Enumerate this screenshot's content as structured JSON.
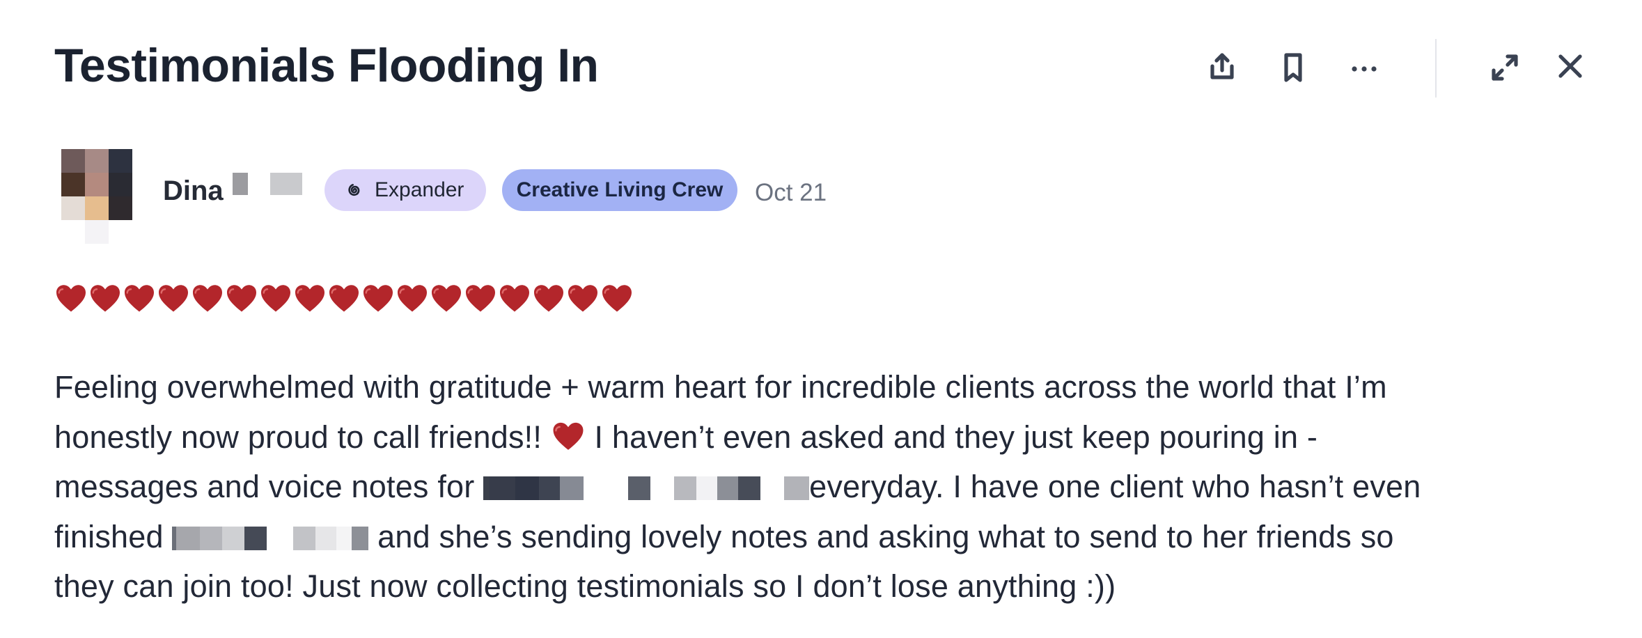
{
  "post": {
    "title": "Testimonials Flooding In",
    "author_name": "Dina",
    "badges": {
      "expander_label": "Expander",
      "group_label": "Creative Living Crew"
    },
    "date": "Oct 21",
    "hearts_count": 17,
    "body": {
      "line1": "Feeling overwhelmed with gratitude + warm heart for incredible clients across the world that I’m",
      "line2a": "honestly now proud to call friends!!",
      "line2b": " I haven’t even asked and they just keep pouring in -",
      "line3a": "messages and voice notes for ",
      "line3b": "everyday. I have one client who hasn’t even",
      "line4a": "finished ",
      "line4b": " and she’s sending lovely notes and asking what to send to her friends so",
      "line5": "they can join too! Just now collecting testimonials so I don’t lose anything :))"
    }
  },
  "toolbar": {
    "icons": [
      "share-icon",
      "bookmark-icon",
      "more-icon",
      "expand-icon",
      "close-icon"
    ]
  },
  "colors": {
    "expander_pill": "#dcd5fa",
    "group_pill": "#a2b1f4",
    "heart": "#b3262b"
  }
}
